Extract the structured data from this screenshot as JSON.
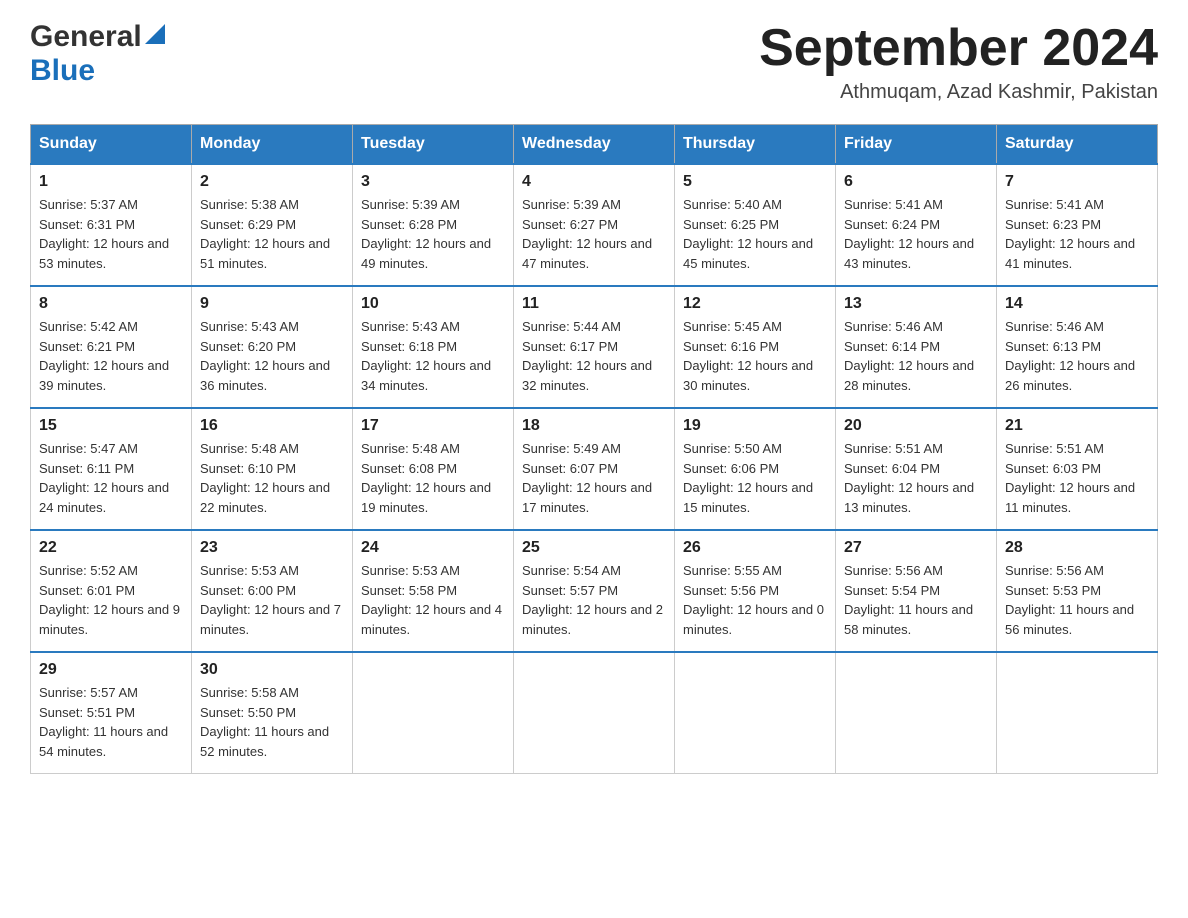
{
  "header": {
    "logo_general": "General",
    "logo_blue": "Blue",
    "month_title": "September 2024",
    "location": "Athmuqam, Azad Kashmir, Pakistan"
  },
  "days_of_week": [
    "Sunday",
    "Monday",
    "Tuesday",
    "Wednesday",
    "Thursday",
    "Friday",
    "Saturday"
  ],
  "weeks": [
    [
      {
        "day": "1",
        "sunrise": "5:37 AM",
        "sunset": "6:31 PM",
        "daylight": "12 hours and 53 minutes."
      },
      {
        "day": "2",
        "sunrise": "5:38 AM",
        "sunset": "6:29 PM",
        "daylight": "12 hours and 51 minutes."
      },
      {
        "day": "3",
        "sunrise": "5:39 AM",
        "sunset": "6:28 PM",
        "daylight": "12 hours and 49 minutes."
      },
      {
        "day": "4",
        "sunrise": "5:39 AM",
        "sunset": "6:27 PM",
        "daylight": "12 hours and 47 minutes."
      },
      {
        "day": "5",
        "sunrise": "5:40 AM",
        "sunset": "6:25 PM",
        "daylight": "12 hours and 45 minutes."
      },
      {
        "day": "6",
        "sunrise": "5:41 AM",
        "sunset": "6:24 PM",
        "daylight": "12 hours and 43 minutes."
      },
      {
        "day": "7",
        "sunrise": "5:41 AM",
        "sunset": "6:23 PM",
        "daylight": "12 hours and 41 minutes."
      }
    ],
    [
      {
        "day": "8",
        "sunrise": "5:42 AM",
        "sunset": "6:21 PM",
        "daylight": "12 hours and 39 minutes."
      },
      {
        "day": "9",
        "sunrise": "5:43 AM",
        "sunset": "6:20 PM",
        "daylight": "12 hours and 36 minutes."
      },
      {
        "day": "10",
        "sunrise": "5:43 AM",
        "sunset": "6:18 PM",
        "daylight": "12 hours and 34 minutes."
      },
      {
        "day": "11",
        "sunrise": "5:44 AM",
        "sunset": "6:17 PM",
        "daylight": "12 hours and 32 minutes."
      },
      {
        "day": "12",
        "sunrise": "5:45 AM",
        "sunset": "6:16 PM",
        "daylight": "12 hours and 30 minutes."
      },
      {
        "day": "13",
        "sunrise": "5:46 AM",
        "sunset": "6:14 PM",
        "daylight": "12 hours and 28 minutes."
      },
      {
        "day": "14",
        "sunrise": "5:46 AM",
        "sunset": "6:13 PM",
        "daylight": "12 hours and 26 minutes."
      }
    ],
    [
      {
        "day": "15",
        "sunrise": "5:47 AM",
        "sunset": "6:11 PM",
        "daylight": "12 hours and 24 minutes."
      },
      {
        "day": "16",
        "sunrise": "5:48 AM",
        "sunset": "6:10 PM",
        "daylight": "12 hours and 22 minutes."
      },
      {
        "day": "17",
        "sunrise": "5:48 AM",
        "sunset": "6:08 PM",
        "daylight": "12 hours and 19 minutes."
      },
      {
        "day": "18",
        "sunrise": "5:49 AM",
        "sunset": "6:07 PM",
        "daylight": "12 hours and 17 minutes."
      },
      {
        "day": "19",
        "sunrise": "5:50 AM",
        "sunset": "6:06 PM",
        "daylight": "12 hours and 15 minutes."
      },
      {
        "day": "20",
        "sunrise": "5:51 AM",
        "sunset": "6:04 PM",
        "daylight": "12 hours and 13 minutes."
      },
      {
        "day": "21",
        "sunrise": "5:51 AM",
        "sunset": "6:03 PM",
        "daylight": "12 hours and 11 minutes."
      }
    ],
    [
      {
        "day": "22",
        "sunrise": "5:52 AM",
        "sunset": "6:01 PM",
        "daylight": "12 hours and 9 minutes."
      },
      {
        "day": "23",
        "sunrise": "5:53 AM",
        "sunset": "6:00 PM",
        "daylight": "12 hours and 7 minutes."
      },
      {
        "day": "24",
        "sunrise": "5:53 AM",
        "sunset": "5:58 PM",
        "daylight": "12 hours and 4 minutes."
      },
      {
        "day": "25",
        "sunrise": "5:54 AM",
        "sunset": "5:57 PM",
        "daylight": "12 hours and 2 minutes."
      },
      {
        "day": "26",
        "sunrise": "5:55 AM",
        "sunset": "5:56 PM",
        "daylight": "12 hours and 0 minutes."
      },
      {
        "day": "27",
        "sunrise": "5:56 AM",
        "sunset": "5:54 PM",
        "daylight": "11 hours and 58 minutes."
      },
      {
        "day": "28",
        "sunrise": "5:56 AM",
        "sunset": "5:53 PM",
        "daylight": "11 hours and 56 minutes."
      }
    ],
    [
      {
        "day": "29",
        "sunrise": "5:57 AM",
        "sunset": "5:51 PM",
        "daylight": "11 hours and 54 minutes."
      },
      {
        "day": "30",
        "sunrise": "5:58 AM",
        "sunset": "5:50 PM",
        "daylight": "11 hours and 52 minutes."
      },
      null,
      null,
      null,
      null,
      null
    ]
  ]
}
